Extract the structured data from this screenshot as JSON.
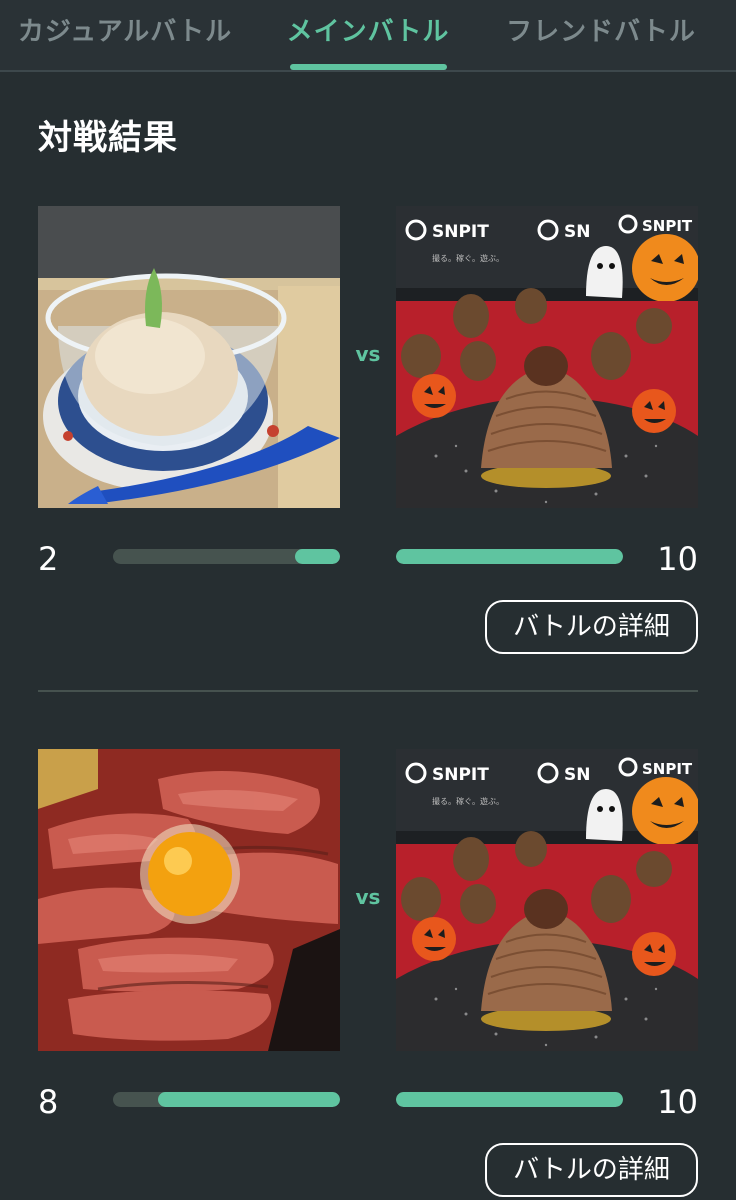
{
  "tabs": [
    {
      "label": "カジュアルバトル",
      "active": false
    },
    {
      "label": "メインバトル",
      "active": true
    },
    {
      "label": "フレンドバトル",
      "active": false
    }
  ],
  "section_title": "対戦結果",
  "colors": {
    "accent": "#5fc4a0",
    "background": "#262e31",
    "bar_track": "#46534f"
  },
  "battles": [
    {
      "left_photo": "ice-cream-photo",
      "right_photo": "mont-blanc-halloween-photo",
      "vs_label": "vs",
      "left_score": "2",
      "right_score": "10",
      "left_share": 0.2,
      "right_share": 1.0,
      "detail_label": "バトルの詳細"
    },
    {
      "left_photo": "roast-beef-bowl-photo",
      "right_photo": "mont-blanc-halloween-photo",
      "vs_label": "vs",
      "left_score": "8",
      "right_score": "10",
      "left_share": 0.8,
      "right_share": 1.0,
      "detail_label": "バトルの詳細"
    }
  ],
  "photo_texts": {
    "brand": "SNPIT",
    "tagline": "撮る。稼ぐ。遊ぶ。"
  }
}
